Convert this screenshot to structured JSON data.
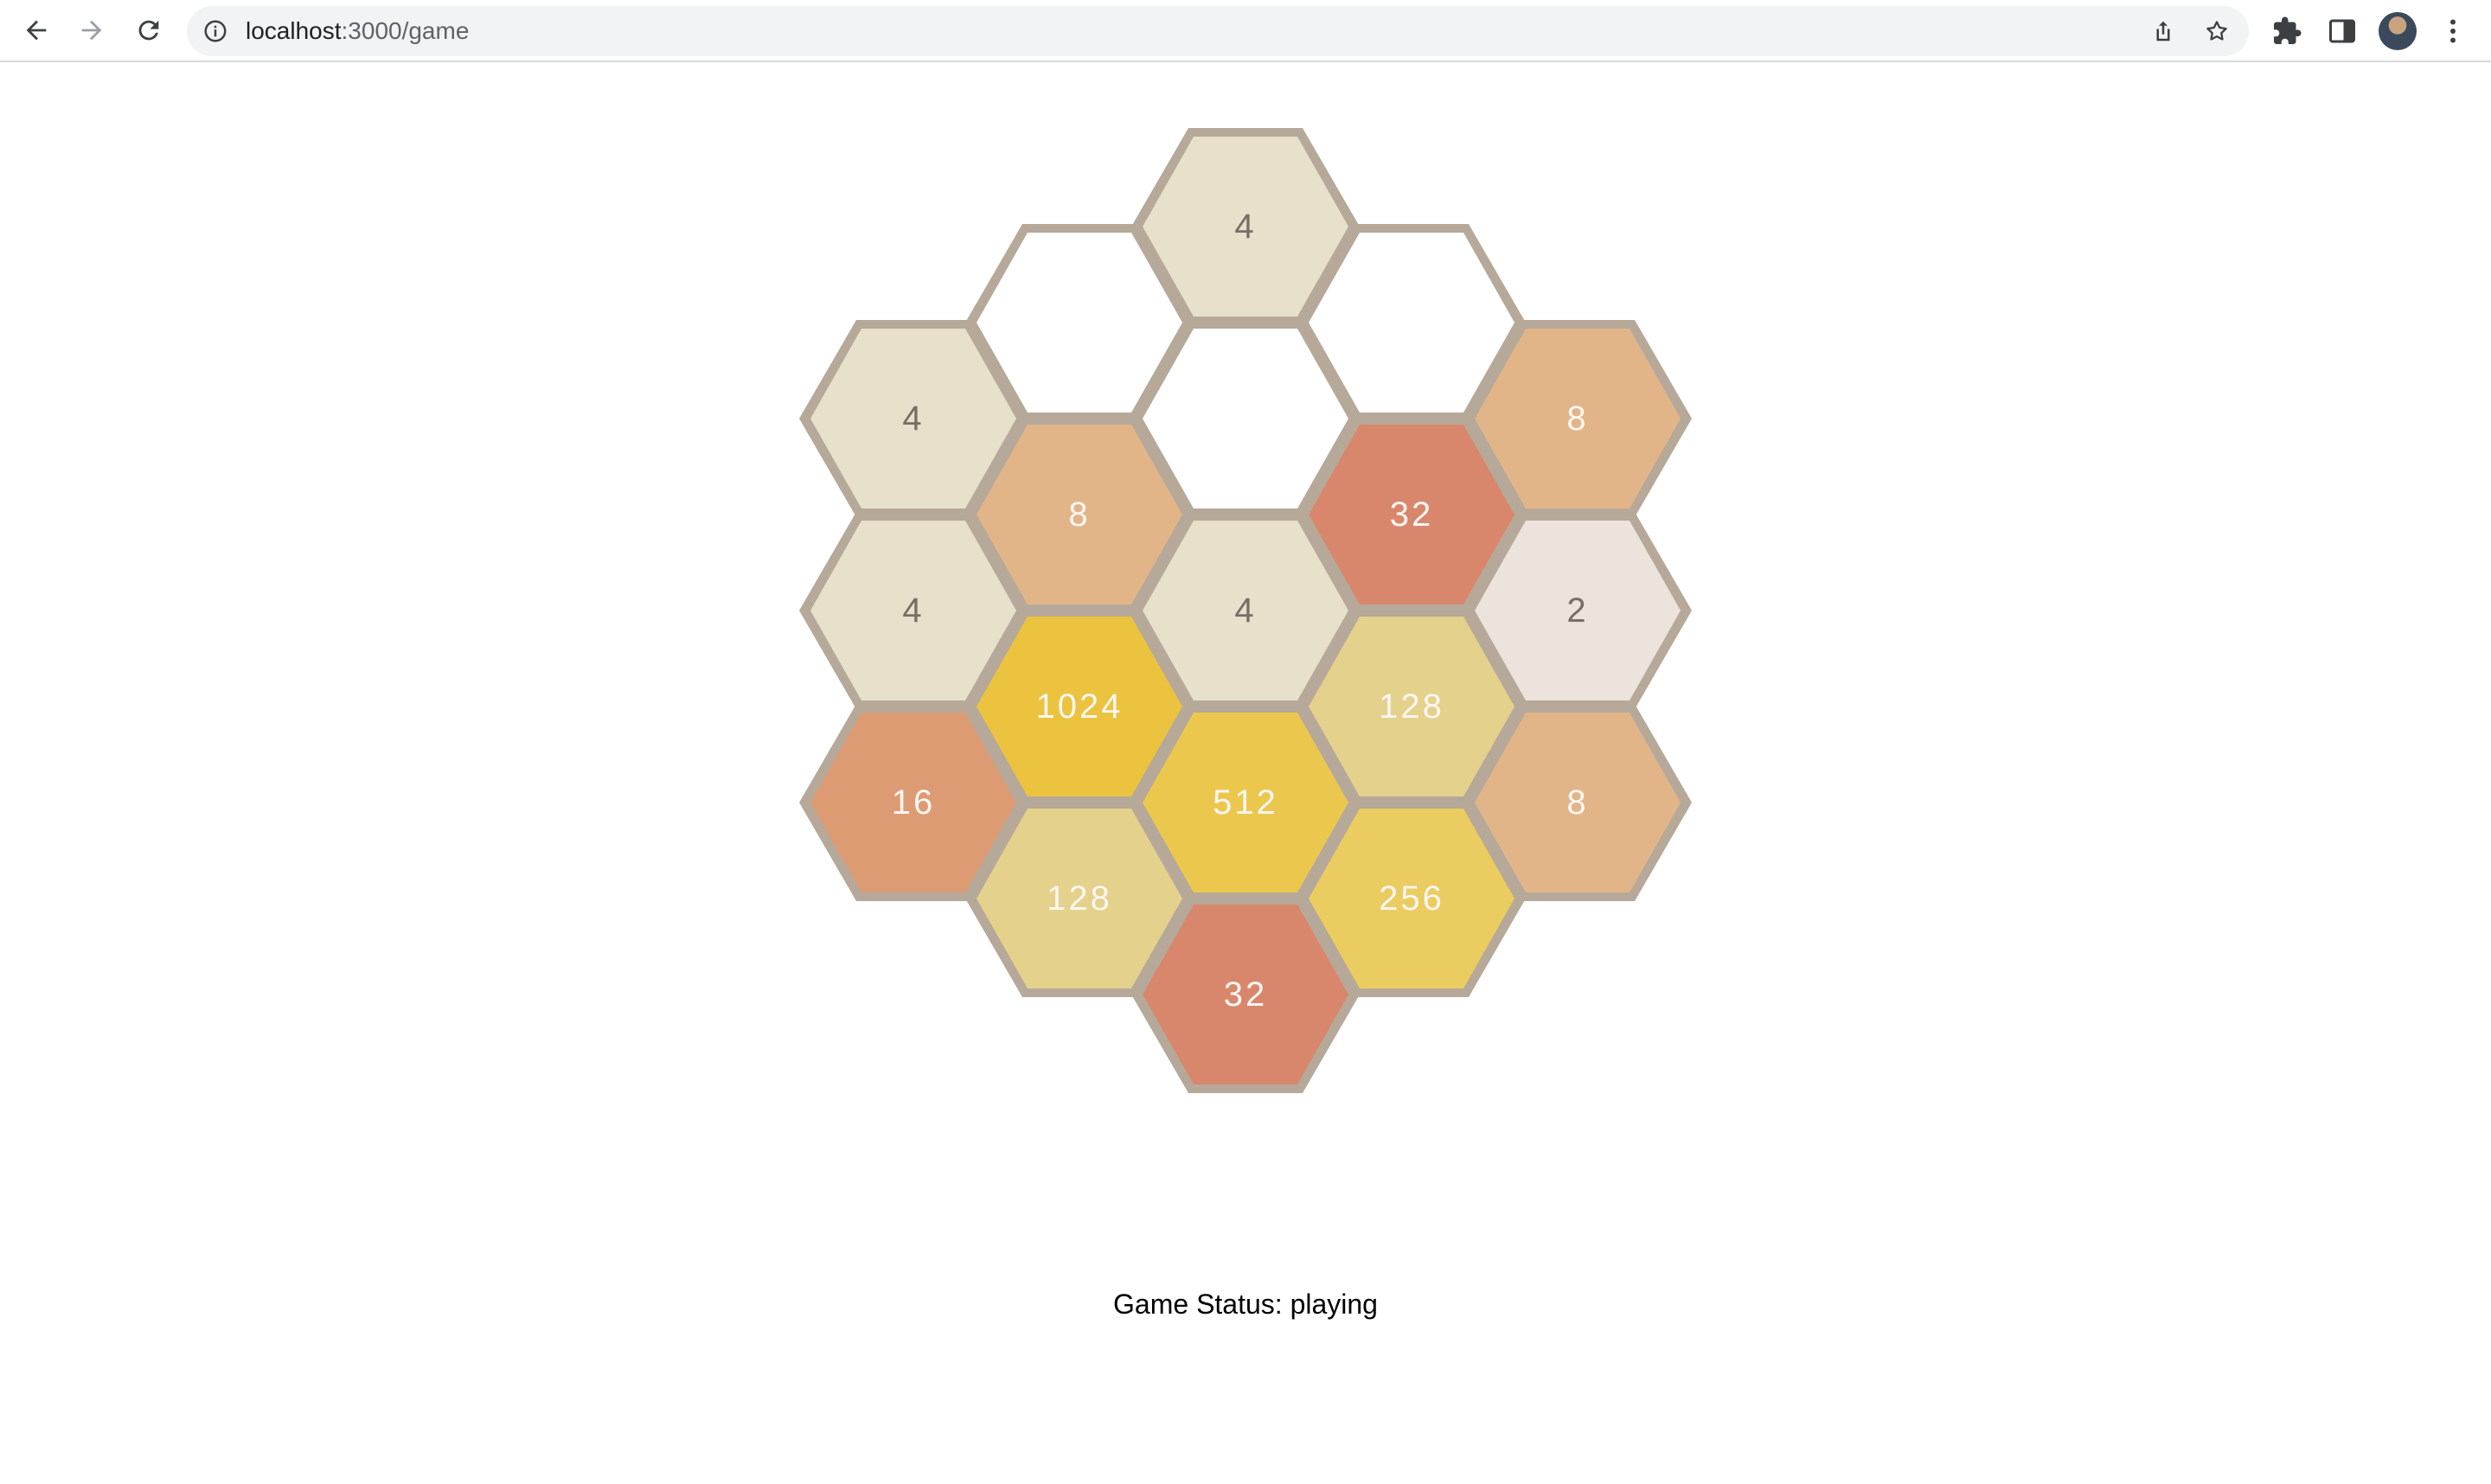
{
  "browser": {
    "url_host": "localhost",
    "url_path": ":3000/game",
    "icons": {
      "back": "back-arrow-icon",
      "forward": "forward-arrow-icon",
      "reload": "reload-icon",
      "site_info": "info-icon",
      "share": "share-icon",
      "bookmark": "star-icon",
      "extensions": "puzzle-icon",
      "side_panel": "side-panel-icon",
      "profile": "avatar",
      "menu": "kebab-menu-icon"
    }
  },
  "theme": {
    "border": "#b6a999",
    "empty": "#ffffff",
    "text_dark": "#776e65",
    "text_light": "#f9f6f2",
    "tile_colors": {
      "2": "#ebe3dc",
      "4": "#e7e0cb",
      "8": "#e2b589",
      "16": "#dd9b74",
      "32": "#d9876c",
      "128": "#e4d18b",
      "256": "#ebcc60",
      "512": "#ebc84d",
      "1024": "#ebc33f"
    }
  },
  "board": {
    "cells": [
      {
        "q": 0,
        "r": -2,
        "value": "4"
      },
      {
        "q": -1,
        "r": -1,
        "value": ""
      },
      {
        "q": 1,
        "r": -2,
        "value": ""
      },
      {
        "q": -2,
        "r": 0,
        "value": "4"
      },
      {
        "q": 0,
        "r": -1,
        "value": ""
      },
      {
        "q": 2,
        "r": -2,
        "value": "8"
      },
      {
        "q": -1,
        "r": 0,
        "value": "8"
      },
      {
        "q": 1,
        "r": -1,
        "value": "32"
      },
      {
        "q": -2,
        "r": 1,
        "value": "4"
      },
      {
        "q": 0,
        "r": 0,
        "value": "4"
      },
      {
        "q": 2,
        "r": -1,
        "value": "2"
      },
      {
        "q": -1,
        "r": 1,
        "value": "1024"
      },
      {
        "q": 1,
        "r": 0,
        "value": "128"
      },
      {
        "q": -2,
        "r": 2,
        "value": "16"
      },
      {
        "q": 0,
        "r": 1,
        "value": "512"
      },
      {
        "q": 2,
        "r": 0,
        "value": "8"
      },
      {
        "q": -1,
        "r": 2,
        "value": "128"
      },
      {
        "q": 1,
        "r": 1,
        "value": "256"
      },
      {
        "q": 0,
        "r": 2,
        "value": "32"
      }
    ]
  },
  "status": {
    "text": "Game Status: playing"
  }
}
